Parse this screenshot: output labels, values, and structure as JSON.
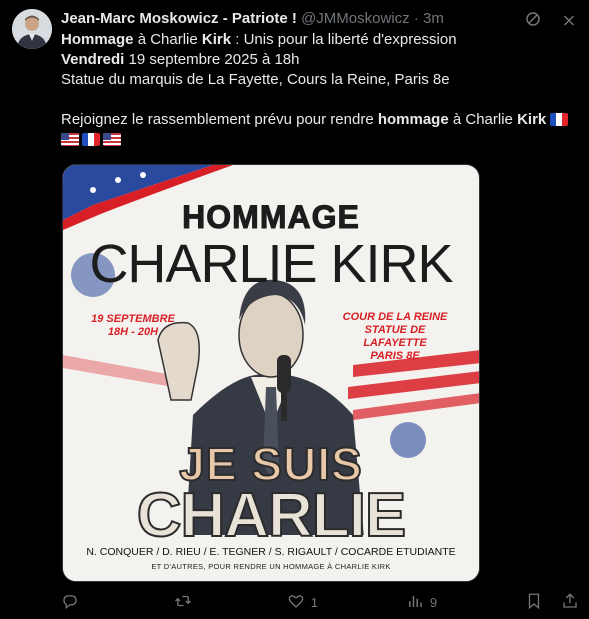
{
  "post": {
    "author_name": "Jean-Marc Moskowicz - Patriote !",
    "author_handle": "@JMMoskowicz",
    "separator": "·",
    "time": "3m",
    "line1_bold": "Hommage",
    "line1_mid": " à Charlie ",
    "line1_bold2": "Kirk",
    "line1_rest": " : Unis pour la liberté d'expression",
    "line2_bold": "Vendredi",
    "line2_rest": " 19 septembre 2025 à 18h",
    "line3": "Statue du marquis de La Fayette, Cours la Reine, Paris 8e",
    "line4_start": "Rejoignez le rassemblement prévu pour rendre ",
    "line4_bold": "hommage",
    "line4_mid": " à Charlie ",
    "line4_bold2": "Kirk",
    "flags_line1": [
      "fr-flag"
    ],
    "flags_line2": [
      "us-flag",
      "fr-flag",
      "us-flag"
    ]
  },
  "poster": {
    "hommage": "HOMMAGE",
    "charlie_kirk": "CHARLIE KIRK",
    "date_line1": "19 SEPTEMBRE",
    "date_line2": "18H - 20H",
    "place_line1": "COUR DE LA REINE",
    "place_line2": "STATUE DE LAFAYETTE",
    "place_line3": "PARIS 8E",
    "je_suis": "JE SUIS",
    "charlie": "CHARLIE",
    "names": "N. CONQUER / D. RIEU / E. TEGNER / S. RIGAULT / COCARDE ETUDIANTE",
    "others": "ET D'AUTRES, POUR RENDRE UN HOMMAGE À CHARLIE KIRK",
    "accent_red": "#d81f26",
    "accent_blue": "#2a4aa0"
  },
  "actions": {
    "reply_count": "",
    "repost_count": "",
    "like_count": "1",
    "views_count": "9"
  },
  "icons": {
    "grok": "grok-icon",
    "more": "more-icon",
    "reply": "reply-icon",
    "repost": "repost-icon",
    "like": "heart-icon",
    "views": "views-icon",
    "bookmark": "bookmark-icon",
    "share": "share-icon"
  }
}
